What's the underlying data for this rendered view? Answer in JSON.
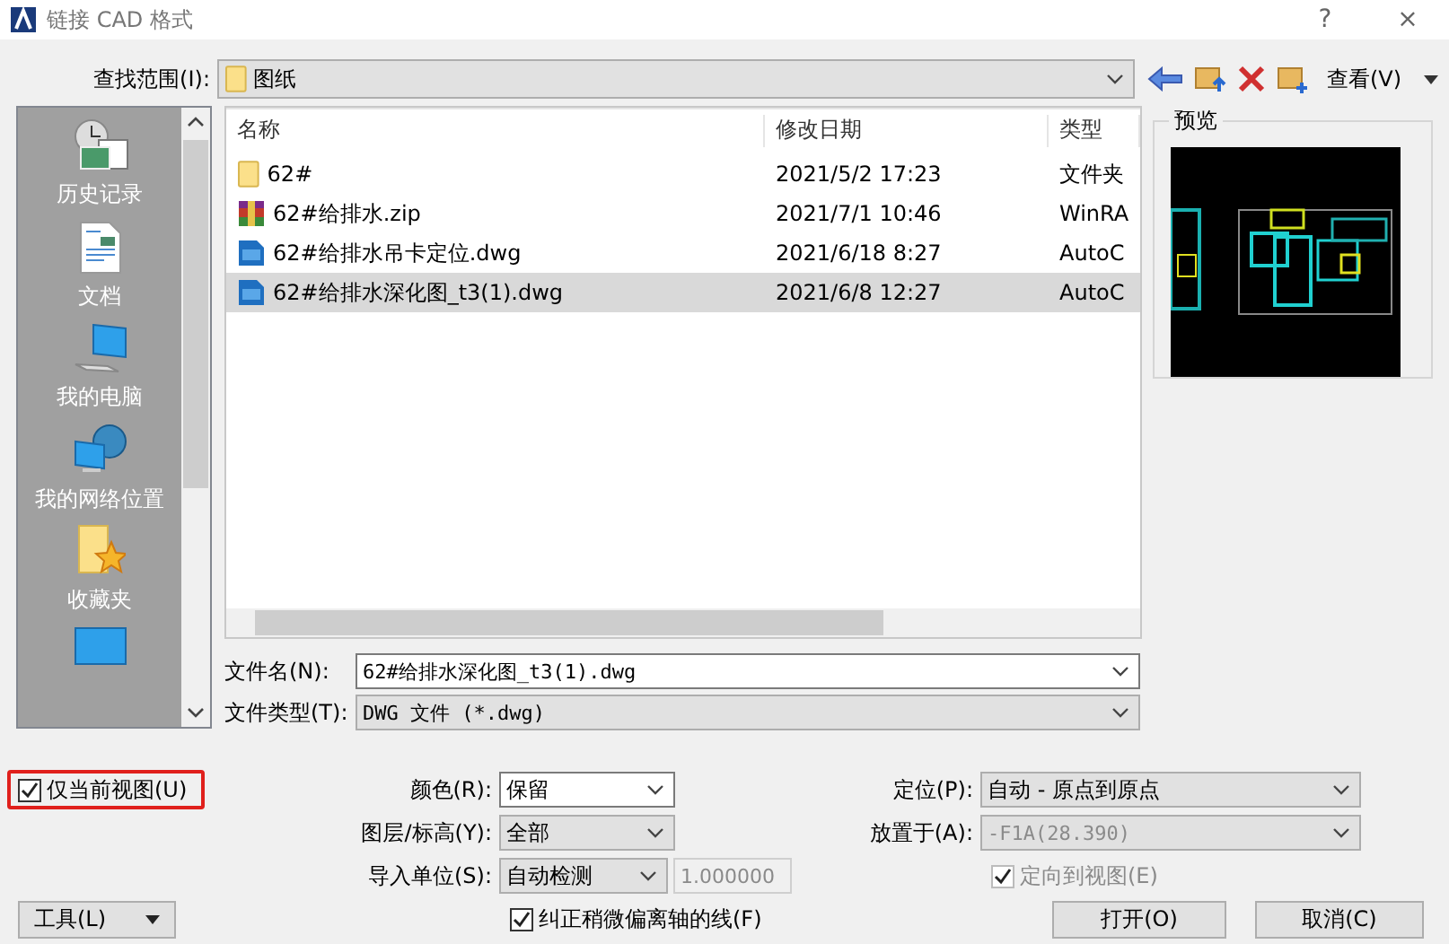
{
  "window": {
    "title": "链接 CAD 格式",
    "help": "?",
    "close": "×"
  },
  "look_in": {
    "label": "查找范围(I):",
    "value": "图纸"
  },
  "toolbar": {
    "view_label": "查看(V)"
  },
  "places": [
    {
      "kind": "history",
      "label": "历史记录"
    },
    {
      "kind": "document",
      "label": "文档"
    },
    {
      "kind": "computer",
      "label": "我的电脑"
    },
    {
      "kind": "network",
      "label": "我的网络位置"
    },
    {
      "kind": "favorites",
      "label": "收藏夹"
    },
    {
      "kind": "desktop"
    }
  ],
  "file_list": {
    "columns": [
      "名称",
      "修改日期",
      "类型"
    ],
    "rows": [
      {
        "kind": "folder",
        "name": "62#",
        "date": "2021/5/2 17:23",
        "type": "文件夹",
        "selected": false
      },
      {
        "kind": "zip",
        "name": "62#给排水.zip",
        "date": "2021/7/1 10:46",
        "type": "WinRA",
        "selected": false
      },
      {
        "kind": "dwg",
        "name": "62#给排水吊卡定位.dwg",
        "date": "2021/6/18 8:27",
        "type": "AutoC",
        "selected": false
      },
      {
        "kind": "dwg",
        "name": "62#给排水深化图_t3(1).dwg",
        "date": "2021/6/8 12:27",
        "type": "AutoC",
        "selected": true
      }
    ]
  },
  "preview": {
    "label": "预览"
  },
  "file_name": {
    "label": "文件名(N):",
    "value": "62#给排水深化图_t3(1).dwg"
  },
  "file_type": {
    "label": "文件类型(T):",
    "value": "DWG 文件 (*.dwg)"
  },
  "current_view_only": {
    "label": "仅当前视图(U)",
    "checked": true,
    "highlighted": true
  },
  "color": {
    "label": "颜色(R):",
    "value": "保留"
  },
  "layers": {
    "label": "图层/标高(Y):",
    "value": "全部"
  },
  "import_units": {
    "label": "导入单位(S):",
    "value": "自动检测",
    "scale": "1.000000",
    "scale_disabled": true
  },
  "correct_lines": {
    "label": "纠正稍微偏离轴的线(F)",
    "checked": true
  },
  "positioning": {
    "label": "定位(P):",
    "value": "自动 - 原点到原点"
  },
  "place_at": {
    "label": "放置于(A):",
    "value": "-F1A(28.390)",
    "disabled": true
  },
  "orient_to_view": {
    "label": "定向到视图(E)",
    "checked": true,
    "disabled": true
  },
  "buttons": {
    "tools": "工具(L)",
    "open": "打开(O)",
    "cancel": "取消(C)"
  }
}
